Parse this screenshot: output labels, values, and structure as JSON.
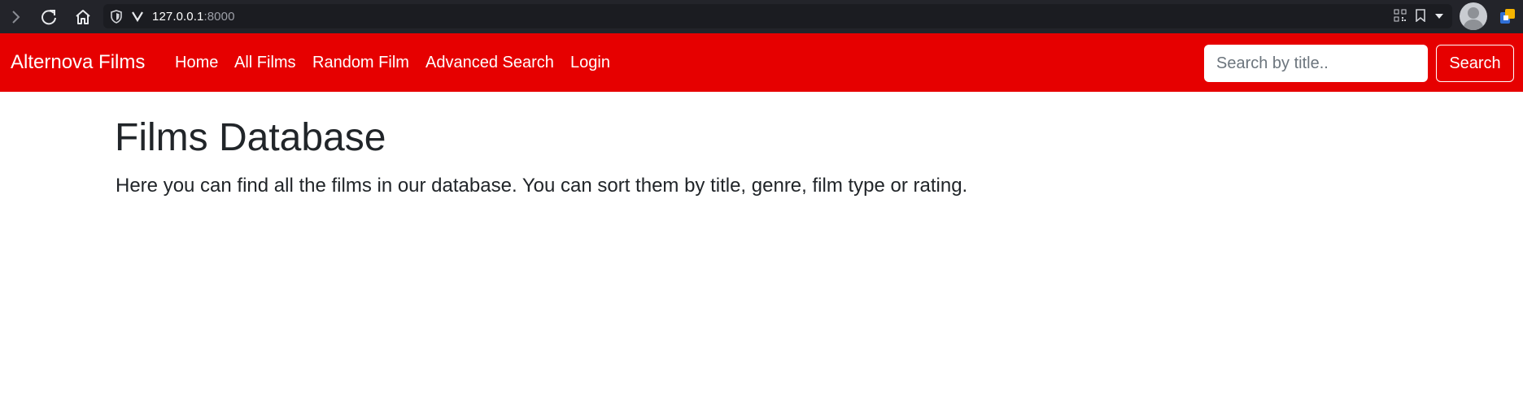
{
  "browser": {
    "url_host": "127.0.0.1",
    "url_port": ":8000",
    "icons": [
      "forward-icon",
      "reload-icon",
      "home-icon",
      "shield-icon",
      "v-icon",
      "qr-code-icon",
      "bookmark-icon",
      "dropdown-icon",
      "profile-avatar",
      "extension-icon"
    ]
  },
  "navbar": {
    "brand": "Alternova Films",
    "links": [
      {
        "label": "Home"
      },
      {
        "label": "All Films"
      },
      {
        "label": "Random Film"
      },
      {
        "label": "Advanced Search"
      },
      {
        "label": "Login"
      }
    ],
    "search_placeholder": "Search by title..",
    "search_button": "Search",
    "background_color": "#e60000"
  },
  "main": {
    "title": "Films Database",
    "lead": "Here you can find all the films in our database. You can sort them by title, genre, film type or rating."
  }
}
